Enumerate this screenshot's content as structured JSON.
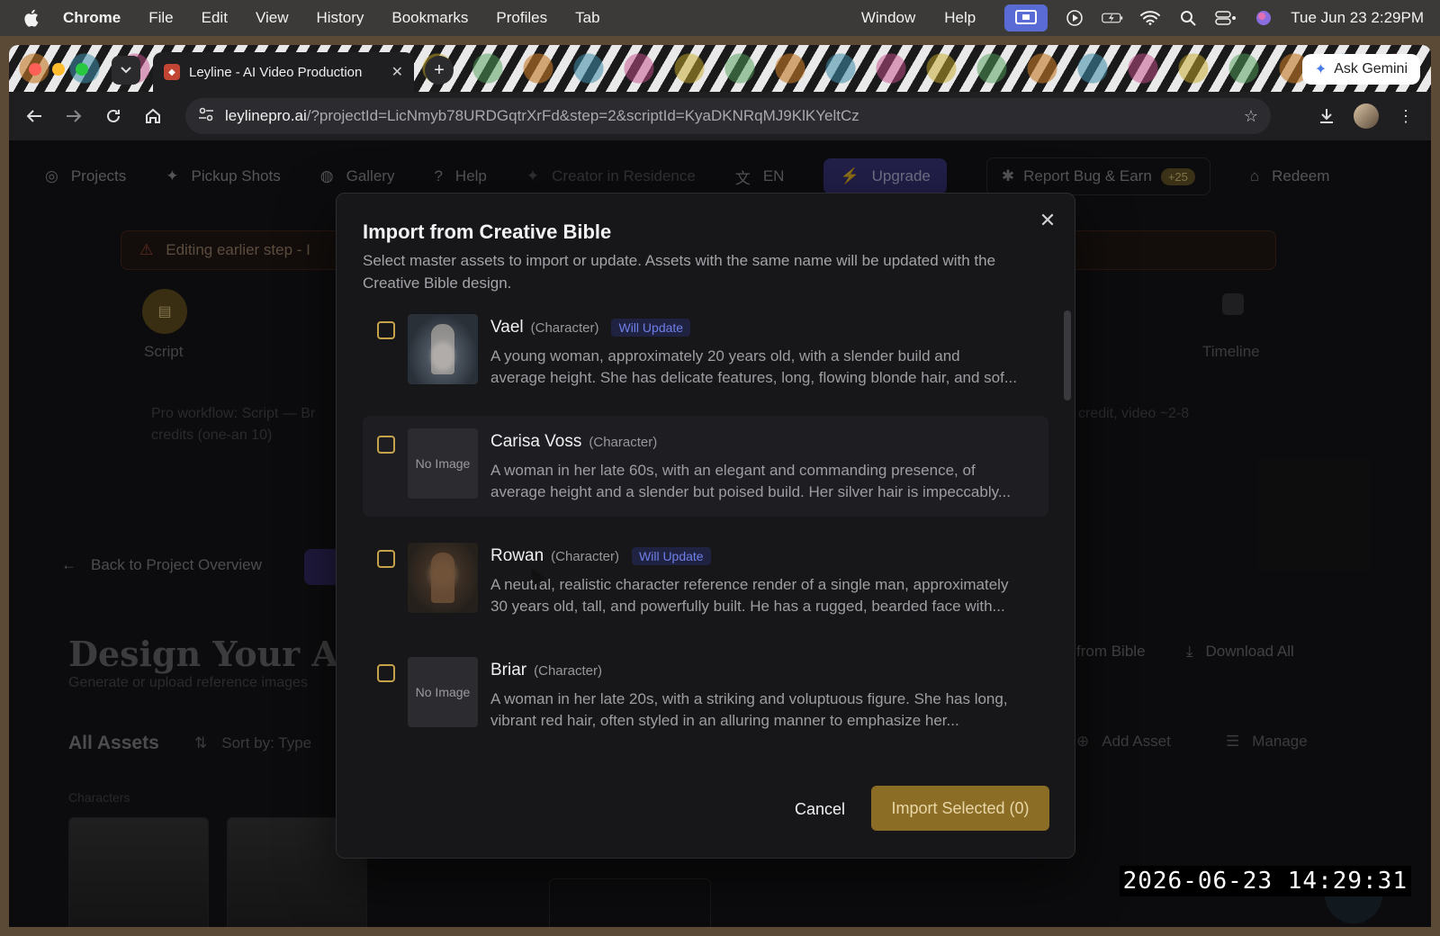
{
  "menubar": {
    "app": "Chrome",
    "items": [
      "File",
      "Edit",
      "View",
      "History",
      "Bookmarks",
      "Profiles",
      "Tab"
    ],
    "right_items": [
      "Window",
      "Help"
    ],
    "clock": "Tue Jun 23  2:29PM"
  },
  "browser": {
    "tab_title": "Leyline - AI Video Production",
    "ask_gemini": "Ask Gemini",
    "url_host": "leylinepro.ai",
    "url_rest": "/?projectId=LicNmyb78URDGqtrXrFd&step=2&scriptId=KyaDKNRqMJ9KlKYeltCz"
  },
  "app_nav": {
    "projects": "Projects",
    "pickup": "Pickup Shots",
    "gallery": "Gallery",
    "help": "Help",
    "creator": "Creator in Residence",
    "lang": "EN",
    "upgrade": "Upgrade",
    "report": "Report Bug & Earn",
    "report_badge": "+25",
    "redeem": "Redeem"
  },
  "background": {
    "warning": "Editing earlier step - I",
    "step_label": "Script",
    "timeline_label": "Timeline",
    "workflow_note_left": "Pro workflow: Script — Br",
    "workflow_note_left2": "credits (one-an         10)",
    "workflow_note_right": "credit, video ~2-8",
    "back": "Back to Project Overview",
    "design_title": "Design Your Assets",
    "design_sub": "Generate or upload reference images",
    "all_assets": "All Assets",
    "sort_by": "Sort by: Type",
    "characters": "Characters",
    "from_bible": "from Bible",
    "download_all": "Download All",
    "add_asset": "Add Asset",
    "manage": "Manage"
  },
  "modal": {
    "title": "Import from Creative Bible",
    "description": "Select master assets to import or update. Assets with the same name will be updated with the Creative Bible design.",
    "no_image": "No Image",
    "update_badge": "Will Update",
    "cancel": "Cancel",
    "import": "Import Selected (0)",
    "assets": [
      {
        "name": "Vael",
        "type": "(Character)",
        "line1": "A young woman, approximately 20 years old, with a slender build and",
        "line2": "average height. She has delicate features, long, flowing blonde hair, and sof..."
      },
      {
        "name": "Carisa Voss",
        "type": "(Character)",
        "line1": "A woman in her late 60s, with an elegant and commanding presence, of",
        "line2": "average height and a slender but poised build. Her silver hair is impeccably..."
      },
      {
        "name": "Rowan",
        "type": "(Character)",
        "line1": "A neutral, realistic character reference render of a single man, approximately",
        "line2": "30 years old, tall, and powerfully built. He has a rugged, bearded face with..."
      },
      {
        "name": "Briar",
        "type": "(Character)",
        "line1": "A woman in her late 20s, with a striking and voluptuous figure. She has long,",
        "line2": "vibrant red hair, often styled in an alluring manner to emphasize her..."
      }
    ]
  },
  "overlay_timestamp": "2026-06-23  14:29:31",
  "colors": {
    "accent_gold": "#8c6d26",
    "checkbox_gold": "#c6a24a",
    "update_blue": "#6f7fe8"
  }
}
